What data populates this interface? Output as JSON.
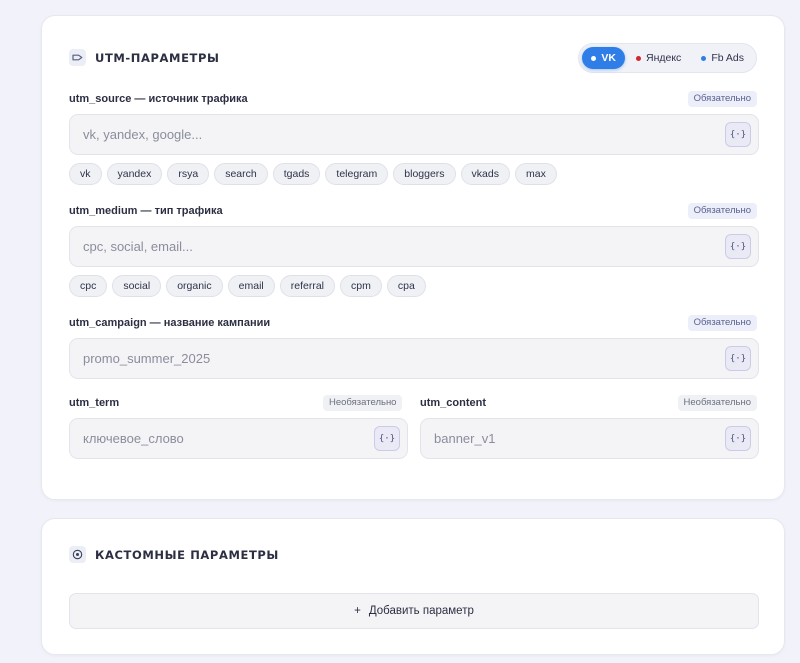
{
  "utm_section": {
    "title": "UTM-ПАРАМЕТРЫ",
    "icon": "tag-icon",
    "presets": [
      {
        "label": "VK",
        "active": true,
        "dot_color": "#ffffff"
      },
      {
        "label": "Яндекс",
        "active": false,
        "dot_color": "#d0262e"
      },
      {
        "label": "Fb Ads",
        "active": false,
        "dot_color": "#2f7de6"
      }
    ],
    "variable_button_label": "{·}",
    "fields": {
      "source": {
        "label": "utm_source — источник трафика",
        "badge": "Обязательно",
        "placeholder": "vk, yandex, google...",
        "chips": [
          "vk",
          "yandex",
          "rsya",
          "search",
          "tgads",
          "telegram",
          "bloggers",
          "vkads",
          "max"
        ]
      },
      "medium": {
        "label": "utm_medium — тип трафика",
        "badge": "Обязательно",
        "placeholder": "cpc, social, email...",
        "chips": [
          "cpc",
          "social",
          "organic",
          "email",
          "referral",
          "cpm",
          "cpa"
        ]
      },
      "campaign": {
        "label": "utm_campaign — название кампании",
        "badge": "Обязательно",
        "placeholder": "promo_summer_2025"
      },
      "term": {
        "label": "utm_term",
        "badge": "Необязательно",
        "placeholder": "ключевое_слово"
      },
      "content": {
        "label": "utm_content",
        "badge": "Необязательно",
        "placeholder": "banner_v1"
      }
    }
  },
  "custom_section": {
    "title": "КАСТОМНЫЕ ПАРАМЕТРЫ",
    "icon": "settings-icon",
    "add_button_icon": "+",
    "add_button_label": "Добавить параметр"
  },
  "colors": {
    "accent": "#2f7de6",
    "background": "#f2f3fa",
    "card": "#ffffff"
  }
}
